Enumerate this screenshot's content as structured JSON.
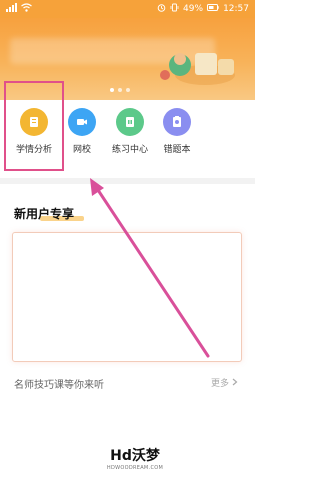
{
  "status": {
    "right_text": "49%",
    "time": "12:57",
    "left_icons": [
      "signal-icon",
      "wifi-icon"
    ],
    "right_icons": [
      "alarm-icon",
      "vibrate-icon",
      "battery-icon"
    ]
  },
  "banner": {
    "dots": 3
  },
  "nav": {
    "items": [
      {
        "label": "学情分析",
        "icon": "analysis-icon",
        "color": "#f3b632"
      },
      {
        "label": "网校",
        "icon": "video-icon",
        "color": "#3da5f4"
      },
      {
        "label": "练习中心",
        "icon": "practice-icon",
        "color": "#5cc98a"
      },
      {
        "label": "错题本",
        "icon": "notebook-icon",
        "color": "#8a8ef0"
      }
    ]
  },
  "section": {
    "title": "新用户专享"
  },
  "teacher": {
    "text": "名师技巧课等你来听",
    "more": "更多"
  },
  "watermark": {
    "main": "Hd沃梦",
    "sub": "HDWOODREAM.COM"
  },
  "colors": {
    "accent": "#f6a23a",
    "highlight": "#e0508a"
  }
}
